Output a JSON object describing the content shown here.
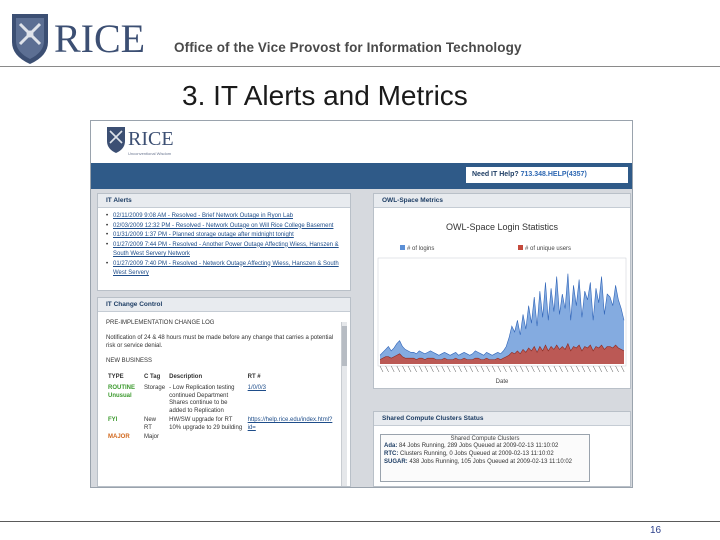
{
  "header": {
    "logo_text": "RICE",
    "office": "Office of the Vice Provost for Information Technology"
  },
  "slide": {
    "title": "3. IT Alerts and Metrics",
    "page_number": "16"
  },
  "screenshot": {
    "site_logo_text": "RICE",
    "site_logo_tagline": "Unconventional Wisdom",
    "help_prefix": "Need IT Help? ",
    "help_number": "713.348.HELP(4357)",
    "alerts": {
      "title": "IT Alerts",
      "items": [
        "02/11/2009 9:08 AM - Resolved - Brief Network Outage in Ryon Lab",
        "02/03/2009 12:32 PM - Resolved - Network Outage on Will Rice College Basement",
        "01/31/2009 1:37 PM - Planned storage outage after midnight tonight",
        "01/27/2009 7:44 PM - Resolved - Another Power Outage Affecting Wiess, Hanszen & South West Servery Network",
        "01/27/2009 7:40 PM - Resolved - Network Outage Affecting Wiess, Hanszen & South West Servery"
      ]
    },
    "change_control": {
      "title": "IT Change Control",
      "log_title": "PRE-IMPLEMENTATION CHANGE LOG",
      "notice": "Notification of 24 & 48 hours must be made before any change that carries a potential risk or service denial.",
      "new_business": "NEW BUSINESS",
      "columns": [
        "TYPE",
        "C Tag",
        "Description",
        "RT #"
      ],
      "rows": [
        {
          "type": "ROUTINE Unusual",
          "tag": "Storage",
          "desc": "- Low Replication testing continued Department Shares continue to be added to Replication",
          "rt": "1/0/0/3",
          "extra": ""
        },
        {
          "type": "FYI",
          "tag": "New RT",
          "desc": "HW/SW upgrade for RT 10% upgrade to 29 building",
          "rt": "https://help.rice.edu/index.html?id=",
          "extra": ""
        },
        {
          "type": "MAJOR",
          "tag": "Major",
          "desc": "",
          "rt": "",
          "extra": ""
        }
      ]
    },
    "owl_space": {
      "title": "OWL-Space Metrics",
      "chart_data": {
        "type": "area",
        "title": "OWL-Space Login Statistics",
        "xlabel": "Date",
        "ylabel": "",
        "series": [
          {
            "name": "# of logins",
            "color": "#5b8fd6",
            "values": [
              6,
              8,
              10,
              12,
              9,
              11,
              14,
              16,
              12,
              10,
              9,
              8,
              8,
              7,
              9,
              8,
              7,
              8,
              9,
              8,
              7,
              6,
              7,
              8,
              7,
              6,
              7,
              8,
              6,
              7,
              8,
              7,
              6,
              7,
              9,
              8,
              7,
              6,
              8,
              7,
              6,
              7,
              8,
              7,
              9,
              12,
              18,
              26,
              22,
              30,
              20,
              34,
              24,
              40,
              28,
              46,
              26,
              50,
              32,
              56,
              30,
              52,
              36,
              60,
              34,
              48,
              38,
              62,
              30,
              54,
              40,
              58,
              32,
              50,
              44,
              56,
              30,
              52,
              42,
              60,
              34,
              48,
              46,
              40,
              54,
              44,
              38,
              30
            ]
          },
          {
            "name": "# of unique users",
            "color": "#c44a3c",
            "values": [
              3,
              4,
              5,
              5,
              4,
              5,
              6,
              7,
              5,
              4,
              4,
              4,
              4,
              3,
              4,
              4,
              3,
              4,
              4,
              4,
              3,
              3,
              3,
              4,
              3,
              3,
              3,
              4,
              3,
              3,
              4,
              3,
              3,
              3,
              4,
              4,
              3,
              3,
              4,
              3,
              3,
              3,
              4,
              3,
              4,
              5,
              6,
              8,
              7,
              9,
              7,
              10,
              8,
              11,
              9,
              12,
              8,
              12,
              9,
              13,
              9,
              12,
              10,
              13,
              10,
              12,
              10,
              14,
              9,
              12,
              11,
              13,
              9,
              12,
              11,
              13,
              9,
              12,
              11,
              13,
              10,
              12,
              12,
              11,
              13,
              11,
              10,
              9
            ]
          }
        ],
        "ylim": [
          0,
          70
        ]
      }
    },
    "clusters": {
      "title": "Shared Compute Clusters Status",
      "box_title": "Shared Compute Clusters",
      "rows": [
        {
          "name": "Ada:",
          "text": "84 Jobs Running, 289 Jobs Queued at 2009-02-13 11:10:02"
        },
        {
          "name": "RTC:",
          "text": "Clusters Running, 0 Jobs Queued at 2009-02-13 11:10:02"
        },
        {
          "name": "SUGAR:",
          "text": "438 Jobs Running, 105 Jobs Queued at 2009-02-13 11:10:02"
        }
      ]
    }
  }
}
